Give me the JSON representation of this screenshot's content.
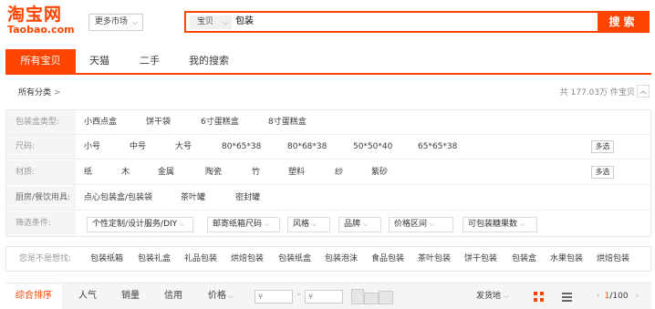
{
  "header": {
    "logo_cn": "淘宝网",
    "logo_en": "Taobao.com",
    "market_label": "更多市场",
    "search_type": "宝贝",
    "search_query": "包装",
    "search_button": "搜索"
  },
  "tabs": [
    "所有宝贝",
    "天猫",
    "二手",
    "我的搜索"
  ],
  "category": {
    "all_label": "所有分类",
    "count_text": "共 177.03万 件宝贝"
  },
  "filters": {
    "box_type": {
      "label": "包装盒类型:",
      "options": [
        "小西点盒",
        "饼干袋",
        "6寸蛋糕盒",
        "8寸蛋糕盒"
      ]
    },
    "size": {
      "label": "尺码:",
      "options": [
        "小号",
        "中号",
        "大号",
        "80*65*38",
        "80*68*38",
        "50*50*40",
        "65*65*38"
      ],
      "multi": "多选"
    },
    "material": {
      "label": "材质:",
      "options": [
        "纸",
        "木",
        "金属",
        "陶瓷",
        "竹",
        "塑料",
        "纱",
        "紫砂"
      ],
      "multi": "多选"
    },
    "kitchen": {
      "label": "厨房/餐饮用具:",
      "options": [
        "点心包装盒/包装袋",
        "茶叶罐",
        "密封罐"
      ]
    },
    "criteria": {
      "label": "筛选条件:",
      "dropdowns": [
        "个性定制/设计服务/DIY",
        "邮寄纸箱尺码",
        "风格",
        "品牌",
        "价格区间",
        "可包装糖果数"
      ]
    }
  },
  "suggestions": {
    "label": "您是不是想找:",
    "items": [
      "包装纸箱",
      "包装礼盒",
      "礼品包装",
      "烘焙包装",
      "包装纸盒",
      "包装泡沫",
      "食品包装",
      "茶叶包装",
      "饼干包装",
      "包装盒",
      "水果包装",
      "烘焙包装"
    ]
  },
  "sort": {
    "items": [
      "综合排序",
      "人气",
      "销量",
      "信用",
      "价格"
    ],
    "price_min": "¥",
    "price_max": "¥",
    "price_dash": "-",
    "location": "发货地",
    "page": "1",
    "page_total": "/100"
  },
  "colors": {
    "brand": "#ff4400"
  }
}
